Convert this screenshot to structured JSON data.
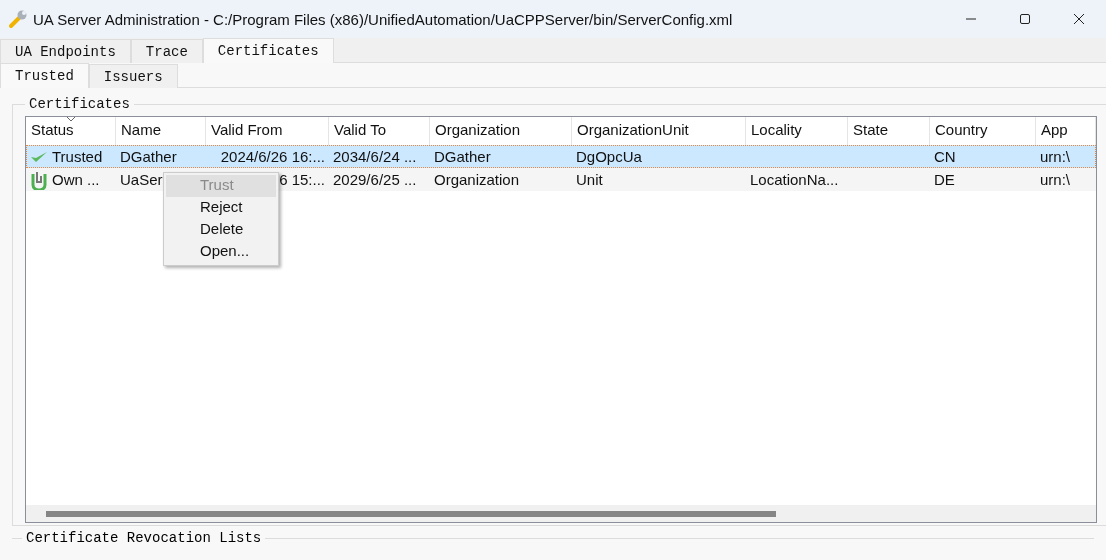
{
  "window": {
    "title": "UA Server Administration - C:/Program Files (x86)/UnifiedAutomation/UaCPPServer/bin/ServerConfig.xml"
  },
  "tabs": [
    {
      "label": "UA Endpoints",
      "selected": false
    },
    {
      "label": "Trace",
      "selected": false
    },
    {
      "label": "Certificates",
      "selected": true
    }
  ],
  "subtabs": [
    {
      "label": "Trusted",
      "selected": true
    },
    {
      "label": "Issuers",
      "selected": false
    }
  ],
  "group": {
    "title": "Certificates"
  },
  "table": {
    "columns": [
      "Status",
      "Name",
      "Valid From",
      "Valid To",
      "Organization",
      "OrganizationUnit",
      "Locality",
      "State",
      "Country",
      "App"
    ],
    "rows": [
      {
        "kind": "trusted",
        "selected": true,
        "cells": [
          "Trusted",
          "DGather",
          "2024/6/26 16:...",
          "2034/6/24 ...",
          "DGather",
          "DgOpcUa",
          "",
          "",
          "CN",
          "urn:\\"
        ]
      },
      {
        "kind": "own",
        "selected": false,
        "cells": [
          "Own ...",
          "UaSer",
          "6 15:...",
          "2029/6/25 ...",
          "Organization",
          "Unit",
          "LocationNa...",
          "",
          "DE",
          "urn:\\"
        ]
      }
    ]
  },
  "context_menu": [
    {
      "label": "Trust",
      "disabled": true,
      "highlighted": true
    },
    {
      "label": "Reject",
      "disabled": false,
      "highlighted": false
    },
    {
      "label": "Delete",
      "disabled": false,
      "highlighted": false
    },
    {
      "label": "Open...",
      "disabled": false,
      "highlighted": false
    }
  ],
  "group2": {
    "title": "Certificate Revocation Lists"
  }
}
